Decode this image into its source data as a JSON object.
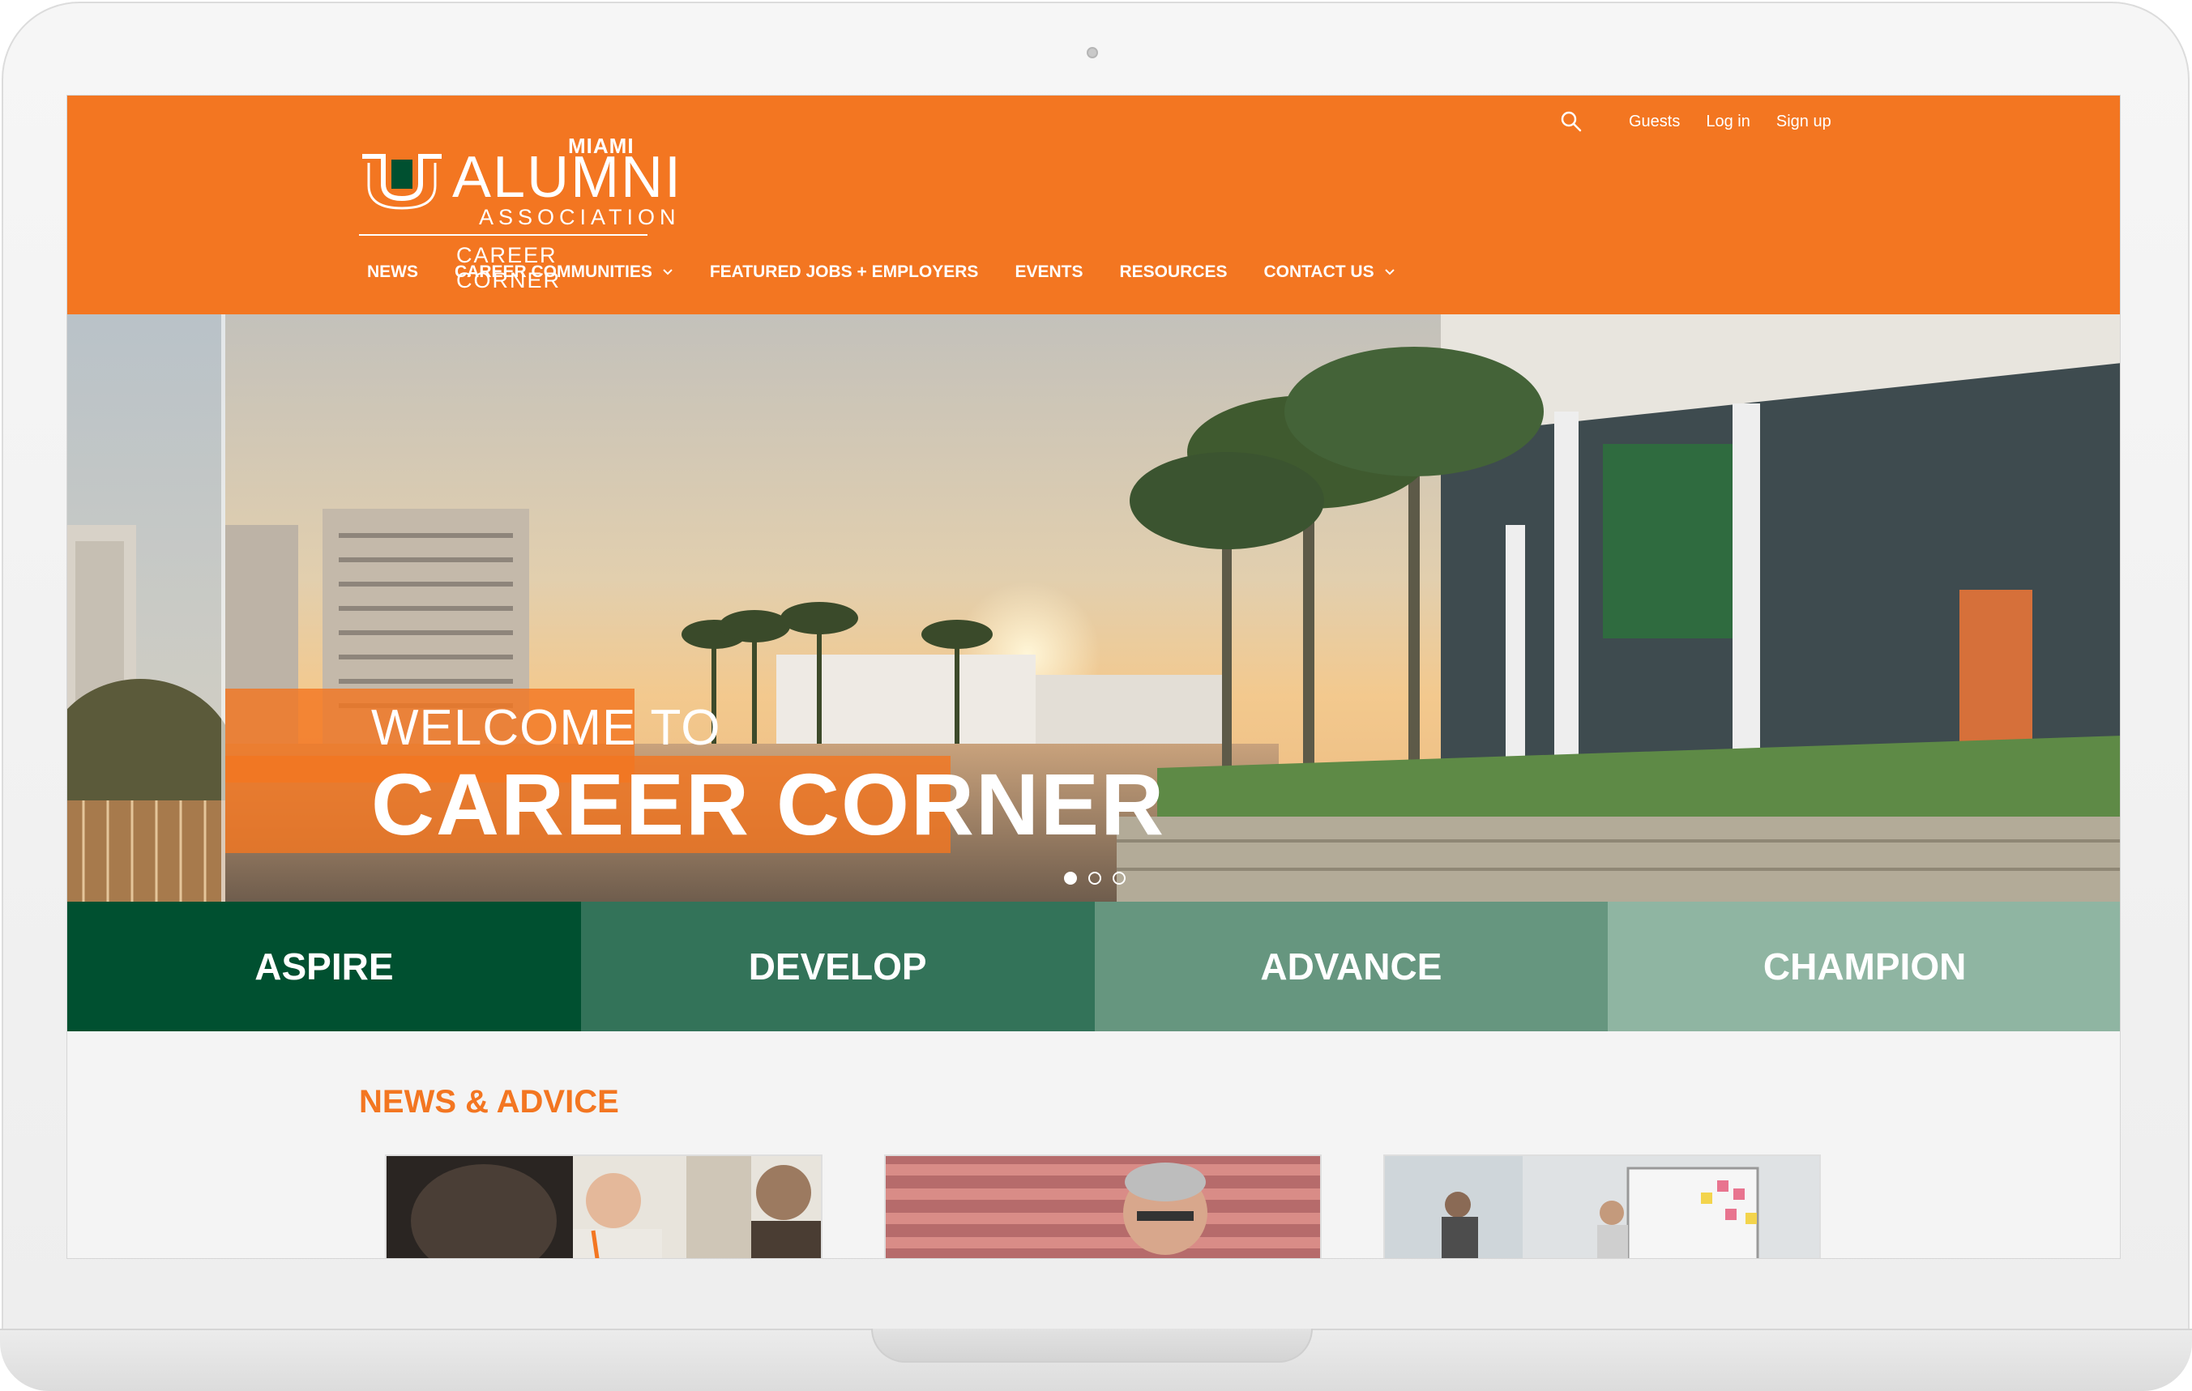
{
  "colors": {
    "brand_orange": "#f37621",
    "pillar_1": "#005030",
    "pillar_2": "#337359",
    "pillar_3": "#66967f",
    "pillar_4": "#8fb5a2",
    "white": "#ffffff"
  },
  "header": {
    "logo": {
      "miami": "MIAMI",
      "alumni": "ALUMNI",
      "association": "ASSOCIATION",
      "career_corner": "CAREER CORNER"
    },
    "search_icon": "search-icon",
    "top_links": [
      "Guests",
      "Log in",
      "Sign up"
    ]
  },
  "nav": {
    "items": [
      {
        "label": "NEWS",
        "dropdown": false
      },
      {
        "label": "CAREER COMMUNITIES",
        "dropdown": true
      },
      {
        "label": "FEATURED JOBS + EMPLOYERS",
        "dropdown": false
      },
      {
        "label": "EVENTS",
        "dropdown": false
      },
      {
        "label": "RESOURCES",
        "dropdown": false
      },
      {
        "label": "CONTACT US",
        "dropdown": true
      }
    ]
  },
  "hero": {
    "welcome_line_1": "WELCOME TO",
    "welcome_line_2": "CAREER CORNER",
    "slide_count": 3,
    "active_slide": 1
  },
  "pillars": [
    "ASPIRE",
    "DEVELOP",
    "ADVANCE",
    "CHAMPION"
  ],
  "news": {
    "title": "NEWS & ADVICE"
  }
}
